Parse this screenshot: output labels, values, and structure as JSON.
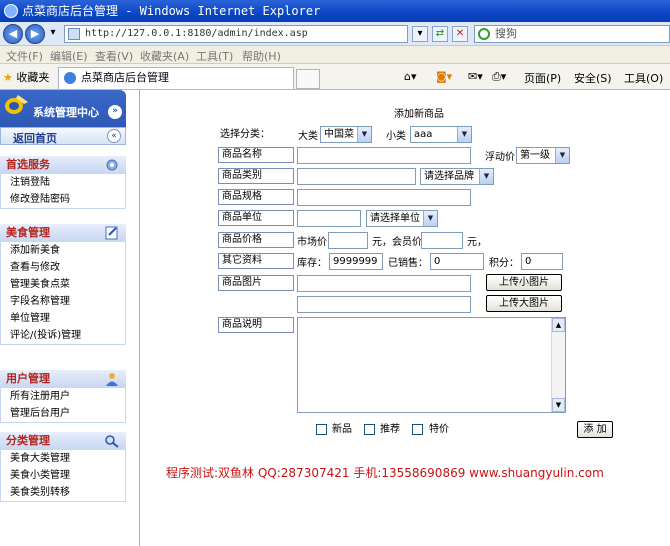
{
  "window": {
    "title": "点菜商店后台管理 - Windows Internet Explorer",
    "address": "http://127.0.0.1:8180/admin/index.asp",
    "search_placeholder": "搜狗"
  },
  "menubar": [
    "文件(F)",
    "编辑(E)",
    "查看(V)",
    "收藏夹(A)",
    "工具(T)",
    "帮助(H)"
  ],
  "favorites": {
    "label": "收藏夹",
    "tab_title": "点菜商店后台管理"
  },
  "toolbar": {
    "page": "页面(P)",
    "safety": "安全(S)",
    "tools": "工具(O)"
  },
  "sidebar": {
    "title": "系统管理中心",
    "home": "返回首页",
    "sections": [
      {
        "title": "首选服务",
        "icon": "gear-icon",
        "items": [
          "注销登陆",
          "修改登陆密码"
        ]
      },
      {
        "title": "美食管理",
        "icon": "notepad-icon",
        "items": [
          "添加新美食",
          "查看与修改",
          "管理美食点菜",
          "字段名称管理",
          "单位管理",
          "评论/(投诉)管理"
        ]
      },
      {
        "title": "用户管理",
        "icon": "user-icon",
        "items": [
          "所有注册用户",
          "管理后台用户"
        ]
      },
      {
        "title": "分类管理",
        "icon": "magnifier-icon",
        "items": [
          "美食大类管理",
          "美食小类管理",
          "美食类别转移"
        ]
      }
    ]
  },
  "form": {
    "heading": "添加新商品",
    "category": {
      "label": "选择分类：",
      "big_label": "大类",
      "big_value": "中国菜",
      "small_label": "小类",
      "small_value": "aaa"
    },
    "name": {
      "label": "商品名称",
      "value": ""
    },
    "float_price": {
      "label": "浮动价",
      "value": "第一级"
    },
    "type": {
      "label": "商品类别",
      "value": "",
      "brand_select": "请选择品牌"
    },
    "spec": {
      "label": "商品规格",
      "value": ""
    },
    "unit": {
      "label": "商品单位",
      "value": "",
      "unit_select": "请选择单位"
    },
    "price": {
      "label": "商品价格",
      "market_label": "市场价",
      "market_value": "",
      "yuan1": "元，会员价",
      "member_value": "",
      "yuan2": "元，"
    },
    "other": {
      "label": "其它资料",
      "stock_label": "库存：",
      "stock_value": "9999999",
      "sold_label": "已销售：",
      "sold_value": "0",
      "points_label": "积分：",
      "points_value": "0"
    },
    "images": {
      "label": "商品图片",
      "small_btn": "上传小图片",
      "big_btn": "上传大图片"
    },
    "desc": {
      "label": "商品说明"
    },
    "checks": {
      "new": "新品",
      "recommend": "推荐",
      "special": "特价"
    },
    "submit": "添 加"
  },
  "credit": "程序测试:双鱼林 QQ:287307421 手机:13558690869 www.shuangyulin.com"
}
